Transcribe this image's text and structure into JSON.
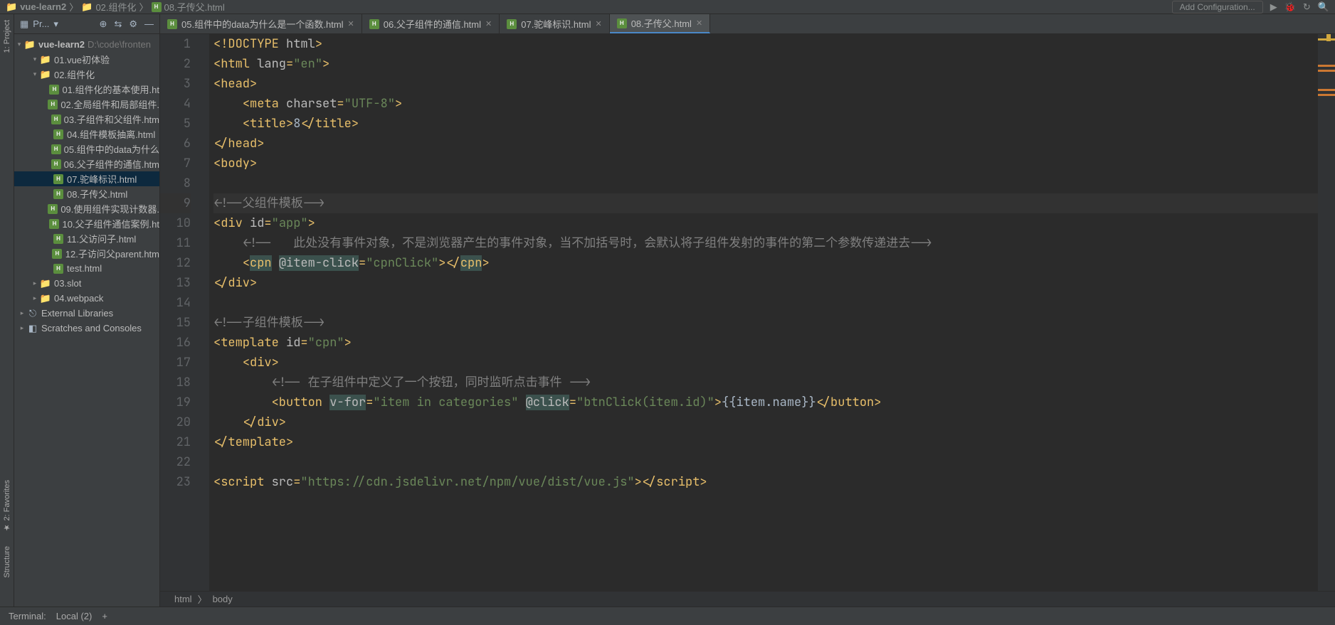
{
  "breadcrumb": {
    "root": "vue-learn2",
    "folder": "02.组件化",
    "file": "08.子传父.html"
  },
  "top_actions": {
    "add_config": "Add Configuration..."
  },
  "project": {
    "header_label": "Pr...",
    "root_name": "vue-learn2",
    "root_path": "D:\\code\\fronten",
    "items": [
      {
        "indent": 1,
        "type": "folder-open",
        "label": "01.vue初体验"
      },
      {
        "indent": 1,
        "type": "folder-open",
        "label": "02.组件化"
      },
      {
        "indent": 2,
        "type": "html",
        "label": "01.组件化的基本使用.ht"
      },
      {
        "indent": 2,
        "type": "html",
        "label": "02.全局组件和局部组件."
      },
      {
        "indent": 2,
        "type": "html",
        "label": "03.子组件和父组件.htm"
      },
      {
        "indent": 2,
        "type": "html",
        "label": "04.组件模板抽离.html"
      },
      {
        "indent": 2,
        "type": "html",
        "label": "05.组件中的data为什么"
      },
      {
        "indent": 2,
        "type": "html",
        "label": "06.父子组件的通信.htm"
      },
      {
        "indent": 2,
        "type": "html",
        "label": "07.驼峰标识.html",
        "selected": true
      },
      {
        "indent": 2,
        "type": "html",
        "label": "08.子传父.html"
      },
      {
        "indent": 2,
        "type": "html",
        "label": "09.使用组件实现计数器."
      },
      {
        "indent": 2,
        "type": "html",
        "label": "10.父子组件通信案例.ht"
      },
      {
        "indent": 2,
        "type": "html",
        "label": "11.父访问子.html"
      },
      {
        "indent": 2,
        "type": "html",
        "label": "12.子访问父parent.htm"
      },
      {
        "indent": 2,
        "type": "html",
        "label": "test.html"
      },
      {
        "indent": 1,
        "type": "folder",
        "label": "03.slot"
      },
      {
        "indent": 1,
        "type": "folder",
        "label": "04.webpack"
      },
      {
        "indent": 0,
        "type": "lib",
        "label": "External Libraries"
      },
      {
        "indent": 0,
        "type": "scratch",
        "label": "Scratches and Consoles"
      }
    ]
  },
  "tabs": [
    {
      "label": "05.组件中的data为什么是一个函数.html",
      "active": false
    },
    {
      "label": "06.父子组件的通信.html",
      "active": false
    },
    {
      "label": "07.驼峰标识.html",
      "active": false
    },
    {
      "label": "08.子传父.html",
      "active": true
    }
  ],
  "code": {
    "lines": [
      {
        "n": 1,
        "html": "<span class='tok-tag'>&lt;!DOCTYPE</span> <span class='tok-attr'>html</span><span class='tok-tag'>&gt;</span>"
      },
      {
        "n": 2,
        "html": "<span class='tok-tag'>&lt;html</span> <span class='tok-attr'>lang</span><span class='tok-tag'>=</span><span class='tok-str'>\"en\"</span><span class='tok-tag'>&gt;</span>"
      },
      {
        "n": 3,
        "html": "<span class='tok-tag'>&lt;head&gt;</span>"
      },
      {
        "n": 4,
        "html": "    <span class='tok-tag'>&lt;meta</span> <span class='tok-attr'>charset</span><span class='tok-tag'>=</span><span class='tok-str'>\"UTF-8\"</span><span class='tok-tag'>&gt;</span>"
      },
      {
        "n": 5,
        "html": "    <span class='tok-tag'>&lt;title&gt;</span><span class='tok-text'>8</span><span class='tok-tag'>&lt;/title&gt;</span>"
      },
      {
        "n": 6,
        "html": "<span class='tok-tag'>&lt;/head&gt;</span>"
      },
      {
        "n": 7,
        "html": "<span class='tok-tag'>&lt;body&gt;</span>"
      },
      {
        "n": 8,
        "html": ""
      },
      {
        "n": 9,
        "html": "<span class='tok-comment'>&lt;!--父组件模板--&gt;</span>",
        "cursor": true
      },
      {
        "n": 10,
        "html": "<span class='tok-tag'>&lt;div</span> <span class='tok-attr'>id</span><span class='tok-tag'>=</span><span class='tok-str'>\"app\"</span><span class='tok-tag'>&gt;</span>"
      },
      {
        "n": 11,
        "html": "    <span class='tok-comment'>&lt;!--   此处没有事件对象，不是浏览器产生的事件对象，当不加括号时，会默认将子组件发射的事件的第二个参数传递进去--&gt;</span>"
      },
      {
        "n": 12,
        "html": "    <span class='tok-tag'>&lt;</span><span class='tok-cust'>cpn</span> <span class='tok-vdir'>@item-click</span><span class='tok-tag'>=</span><span class='tok-str'>\"cpnClick\"</span><span class='tok-tag'>&gt;&lt;/</span><span class='tok-cust'>cpn</span><span class='tok-tag'>&gt;</span>"
      },
      {
        "n": 13,
        "html": "<span class='tok-tag'>&lt;/div&gt;</span>"
      },
      {
        "n": 14,
        "html": ""
      },
      {
        "n": 15,
        "html": "<span class='tok-comment'>&lt;!--子组件模板--&gt;</span>"
      },
      {
        "n": 16,
        "html": "<span class='tok-tag'>&lt;template</span> <span class='tok-attr'>id</span><span class='tok-tag'>=</span><span class='tok-str'>\"cpn\"</span><span class='tok-tag'>&gt;</span>"
      },
      {
        "n": 17,
        "html": "    <span class='tok-tag'>&lt;div&gt;</span>"
      },
      {
        "n": 18,
        "html": "        <span class='tok-comment'>&lt;!-- 在子组件中定义了一个按钮，同时监听点击事件 --&gt;</span>"
      },
      {
        "n": 19,
        "html": "        <span class='tok-tag'>&lt;button</span> <span class='tok-vdir'>v-for</span><span class='tok-tag'>=</span><span class='tok-str'>\"item in categories\"</span> <span class='tok-vdir'>@click</span><span class='tok-tag'>=</span><span class='tok-str'>\"btnClick(item.id)\"</span><span class='tok-tag'>&gt;</span><span class='tok-moustache'>{{item.name}}</span><span class='tok-tag'>&lt;/button&gt;</span>"
      },
      {
        "n": 20,
        "html": "    <span class='tok-tag'>&lt;/div&gt;</span>"
      },
      {
        "n": 21,
        "html": "<span class='tok-tag'>&lt;/template&gt;</span>"
      },
      {
        "n": 22,
        "html": ""
      },
      {
        "n": 23,
        "html": "<span class='tok-tag'>&lt;script</span> <span class='tok-attr'>src</span><span class='tok-tag'>=</span><span class='tok-str'>\"https://cdn.jsdelivr.net/npm/vue/dist/vue.js\"</span><span class='tok-tag'>&gt;&lt;/script&gt;</span>"
      }
    ]
  },
  "breadcrumb_editor": {
    "p1": "html",
    "p2": "body"
  },
  "bottom": {
    "terminal": "Terminal:",
    "local": "Local (2)",
    "plus": "+"
  },
  "side_tabs": {
    "project": "1: Project",
    "favorites": "2: Favorites",
    "structure": "Structure"
  }
}
